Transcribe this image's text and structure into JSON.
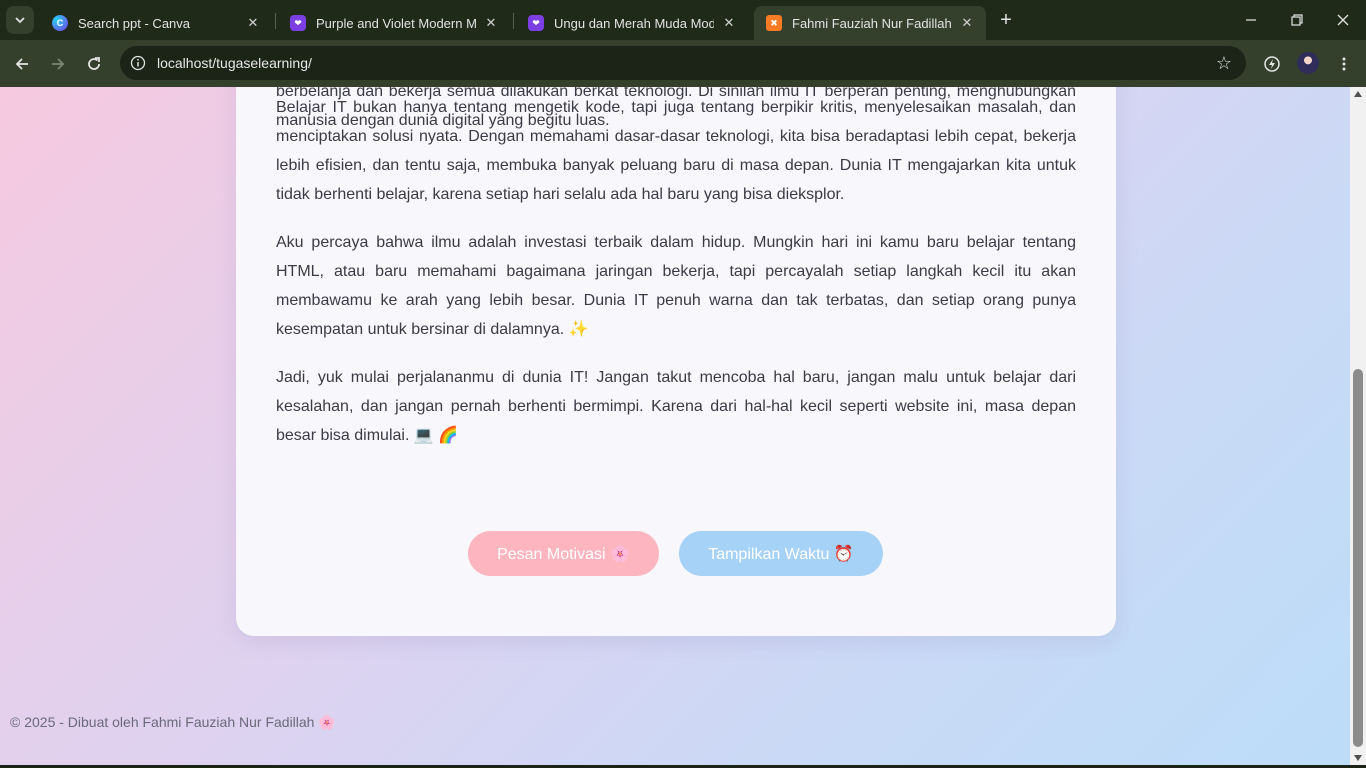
{
  "tabs": [
    {
      "title": "Search ppt - Canva",
      "icon": "canva-icon",
      "active": false
    },
    {
      "title": "Purple and Violet Modern Marke",
      "icon": "canva-design-icon",
      "active": false
    },
    {
      "title": "Ungu dan Merah Muda Modern",
      "icon": "canva-design-icon",
      "active": false
    },
    {
      "title": "Fahmi Fauziah Nur Fadillah",
      "icon": "xampp-icon",
      "active": true
    }
  ],
  "address_bar": {
    "url": "localhost/tugaselearning/"
  },
  "page": {
    "paragraphs": [
      "berbelanja dan bekerja semua dilakukan berkat teknologi. Di sinilah ilmu IT berperan penting, menghubungkan manusia dengan dunia digital yang begitu luas.",
      "Belajar IT bukan hanya tentang mengetik kode, tapi juga tentang berpikir kritis, menyelesaikan masalah, dan menciptakan solusi nyata. Dengan memahami dasar-dasar teknologi, kita bisa beradaptasi lebih cepat, bekerja lebih efisien, dan tentu saja, membuka banyak peluang baru di masa depan. Dunia IT mengajarkan kita untuk tidak berhenti belajar, karena setiap hari selalu ada hal baru yang bisa dieksplor.",
      "Aku percaya bahwa ilmu adalah investasi terbaik dalam hidup. Mungkin hari ini kamu baru belajar tentang HTML, atau baru memahami bagaimana jaringan bekerja, tapi percayalah setiap langkah kecil itu akan membawamu ke arah yang lebih besar. Dunia IT penuh warna dan tak terbatas, dan setiap orang punya kesempatan untuk bersinar di dalamnya. ✨",
      "Jadi, yuk mulai perjalananmu di dunia IT! Jangan takut mencoba hal baru, jangan malu untuk belajar dari kesalahan, dan jangan pernah berhenti bermimpi. Karena dari hal-hal kecil seperti website ini, masa depan besar bisa dimulai. 💻 🌈"
    ],
    "buttons": {
      "motivation": "Pesan Motivasi 🌸",
      "time": "Tampilkan Waktu ⏰"
    },
    "footer": "© 2025 - Dibuat oleh Fahmi Fauziah Nur Fadillah 🌸"
  },
  "colors": {
    "motivation_button": "#fdb6c0",
    "time_button": "#a6d2f7",
    "browser_frame": "#1f2a18",
    "toolbar": "#34402c"
  }
}
